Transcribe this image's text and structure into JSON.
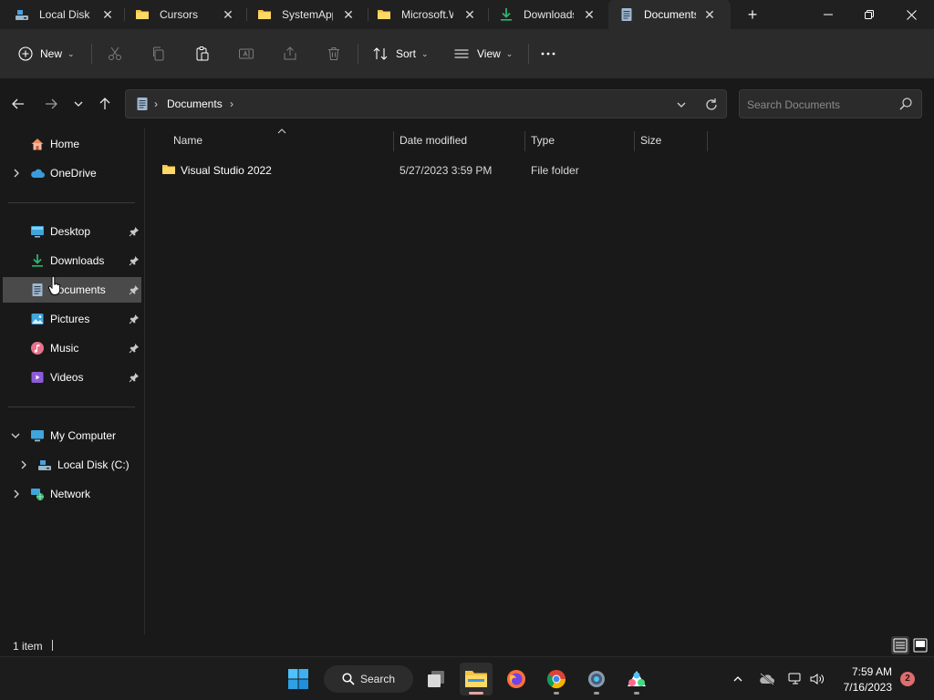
{
  "tabs": [
    {
      "label": "Local Disk",
      "icon": "local-disk-icon",
      "active": false
    },
    {
      "label": "Cursors",
      "icon": "folder-icon",
      "active": false
    },
    {
      "label": "SystemApps",
      "icon": "folder-icon",
      "active": false
    },
    {
      "label": "Microsoft.Windows",
      "icon": "folder-icon",
      "active": false
    },
    {
      "label": "Downloads",
      "icon": "download-icon",
      "active": false
    },
    {
      "label": "Documents",
      "icon": "documents-icon",
      "active": true
    }
  ],
  "toolbar": {
    "new_label": "New",
    "sort_label": "Sort",
    "view_label": "View"
  },
  "address": {
    "crumb": "Documents"
  },
  "search": {
    "placeholder": "Search Documents"
  },
  "nav": {
    "home": "Home",
    "onedrive": "OneDrive",
    "quick_access": [
      {
        "label": "Desktop",
        "icon": "desktop-icon"
      },
      {
        "label": "Downloads",
        "icon": "download-icon"
      },
      {
        "label": "Documents",
        "icon": "documents-icon",
        "selected": true
      },
      {
        "label": "Pictures",
        "icon": "pictures-icon"
      },
      {
        "label": "Music",
        "icon": "music-icon"
      },
      {
        "label": "Videos",
        "icon": "videos-icon"
      }
    ],
    "my_computer": "My Computer",
    "local_disk": "Local Disk (C:)",
    "network": "Network"
  },
  "columns": {
    "name": "Name",
    "date": "Date modified",
    "type": "Type",
    "size": "Size"
  },
  "files": [
    {
      "name": "Visual Studio 2022",
      "date": "5/27/2023 3:59 PM",
      "type": "File folder",
      "size": ""
    }
  ],
  "status": {
    "count": "1 item"
  },
  "taskbar": {
    "search_label": "Search",
    "time": "7:59 AM",
    "date": "7/16/2023",
    "notifications": "2"
  },
  "colors": {
    "accent": "#4cc2ff",
    "folder": "#f5c543",
    "selected_bg": "#4a4a4a",
    "download": "#2fb36d"
  }
}
